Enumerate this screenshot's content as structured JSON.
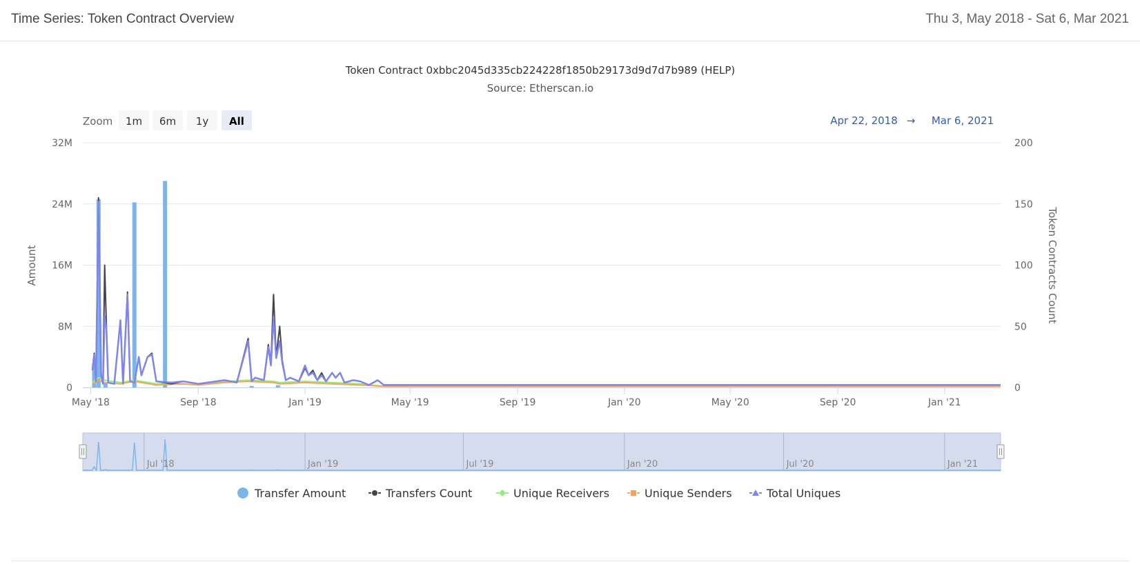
{
  "header": {
    "title": "Time Series: Token Contract Overview",
    "date_range": "Thu 3, May 2018 - Sat 6, Mar 2021"
  },
  "range_selector": {
    "zoom_label": "Zoom",
    "buttons": [
      "1m",
      "6m",
      "1y",
      "All"
    ],
    "active": "All",
    "from": "Apr 22, 2018",
    "arrow": "→",
    "to": "Mar 6, 2021"
  },
  "colors": {
    "transfer_amount": "#7cb5ec",
    "transfers_count": "#434348",
    "unique_receivers": "#90ed7d",
    "unique_senders": "#f7a35c",
    "total_uniques": "#8085e9",
    "navigator_fill": "#ccd6eb"
  },
  "chart_data": {
    "type": "line",
    "title": "Token Contract 0xbbc2045d335cb224228f1850b29173d9d7d7b989 (HELP)",
    "subtitle": "Source: Etherscan.io",
    "x_range": [
      "2018-04-22",
      "2021-03-06"
    ],
    "x_ticks": [
      "May '18",
      "Sep '18",
      "Jan '19",
      "May '19",
      "Sep '19",
      "Jan '20",
      "May '20",
      "Sep '20",
      "Jan '21"
    ],
    "y_left": {
      "label": "Amount",
      "range": [
        0,
        32000000
      ],
      "ticks": [
        "0",
        "8M",
        "16M",
        "24M",
        "32M"
      ]
    },
    "y_right": {
      "label": "Token Contracts Count",
      "range": [
        0,
        200
      ],
      "ticks": [
        "0",
        "50",
        "100",
        "150",
        "200"
      ]
    },
    "navigator_ticks": [
      "Jul '18",
      "Jan '19",
      "Jul '19",
      "Jan '20",
      "Jul '20",
      "Jan '21"
    ],
    "legend": [
      "Transfer Amount",
      "Transfers Count",
      "Unique Receivers",
      "Unique Senders",
      "Total Uniques"
    ],
    "series": [
      {
        "name": "Transfer Amount",
        "type": "column",
        "axis": "left",
        "points": [
          [
            "2018-05-05",
            3000000
          ],
          [
            "2018-05-10",
            24600000
          ],
          [
            "2018-05-18",
            600000
          ],
          [
            "2018-06-20",
            24200000
          ],
          [
            "2018-07-25",
            27000000
          ],
          [
            "2018-11-01",
            200000
          ],
          [
            "2018-12-01",
            300000
          ]
        ]
      },
      {
        "name": "Transfers Count",
        "axis": "right",
        "points": [
          [
            "2018-05-03",
            15
          ],
          [
            "2018-05-05",
            28
          ],
          [
            "2018-05-07",
            5
          ],
          [
            "2018-05-10",
            155
          ],
          [
            "2018-05-13",
            10
          ],
          [
            "2018-05-15",
            3
          ],
          [
            "2018-05-17",
            100
          ],
          [
            "2018-05-19",
            50
          ],
          [
            "2018-05-21",
            4
          ],
          [
            "2018-05-28",
            3
          ],
          [
            "2018-06-04",
            55
          ],
          [
            "2018-06-07",
            3
          ],
          [
            "2018-06-12",
            78
          ],
          [
            "2018-06-15",
            5
          ],
          [
            "2018-06-20",
            4
          ],
          [
            "2018-06-25",
            25
          ],
          [
            "2018-06-28",
            10
          ],
          [
            "2018-07-05",
            25
          ],
          [
            "2018-07-10",
            28
          ],
          [
            "2018-07-15",
            5
          ],
          [
            "2018-08-01",
            3
          ],
          [
            "2018-08-15",
            5
          ],
          [
            "2018-09-01",
            3
          ],
          [
            "2018-10-01",
            6
          ],
          [
            "2018-10-15",
            4
          ],
          [
            "2018-10-28",
            40
          ],
          [
            "2018-11-01",
            5
          ],
          [
            "2018-11-05",
            8
          ],
          [
            "2018-11-15",
            6
          ],
          [
            "2018-11-20",
            35
          ],
          [
            "2018-11-23",
            20
          ],
          [
            "2018-11-26",
            76
          ],
          [
            "2018-11-29",
            25
          ],
          [
            "2018-12-03",
            50
          ],
          [
            "2018-12-06",
            22
          ],
          [
            "2018-12-10",
            6
          ],
          [
            "2018-12-15",
            8
          ],
          [
            "2018-12-25",
            5
          ],
          [
            "2019-01-01",
            16
          ],
          [
            "2019-01-05",
            10
          ],
          [
            "2019-01-10",
            14
          ],
          [
            "2019-01-15",
            6
          ],
          [
            "2019-01-20",
            12
          ],
          [
            "2019-01-25",
            5
          ],
          [
            "2019-02-01",
            12
          ],
          [
            "2019-02-05",
            8
          ],
          [
            "2019-02-10",
            12
          ],
          [
            "2019-02-15",
            4
          ],
          [
            "2019-02-25",
            6
          ],
          [
            "2019-03-05",
            5
          ],
          [
            "2019-03-15",
            2
          ],
          [
            "2019-03-25",
            6
          ],
          [
            "2019-04-01",
            2
          ],
          [
            "2019-04-15",
            2
          ],
          [
            "2019-07-01",
            2
          ],
          [
            "2020-01-01",
            2
          ],
          [
            "2020-07-01",
            2
          ],
          [
            "2021-03-06",
            2
          ]
        ]
      },
      {
        "name": "Unique Receivers",
        "axis": "right",
        "points": [
          [
            "2018-05-03",
            4
          ],
          [
            "2018-05-10",
            8
          ],
          [
            "2018-05-17",
            6
          ],
          [
            "2018-06-04",
            4
          ],
          [
            "2018-06-20",
            6
          ],
          [
            "2018-07-15",
            3
          ],
          [
            "2018-08-15",
            3
          ],
          [
            "2018-09-01",
            2
          ],
          [
            "2018-10-01",
            5
          ],
          [
            "2018-10-28",
            6
          ],
          [
            "2018-11-26",
            5
          ],
          [
            "2018-12-03",
            4
          ],
          [
            "2019-01-01",
            5
          ],
          [
            "2019-02-01",
            4
          ],
          [
            "2019-03-05",
            3
          ],
          [
            "2019-04-01",
            1
          ],
          [
            "2021-03-06",
            1
          ]
        ]
      },
      {
        "name": "Unique Senders",
        "axis": "right",
        "points": [
          [
            "2018-05-03",
            3
          ],
          [
            "2018-05-10",
            6
          ],
          [
            "2018-05-17",
            4
          ],
          [
            "2018-06-04",
            3
          ],
          [
            "2018-06-20",
            5
          ],
          [
            "2018-07-15",
            2
          ],
          [
            "2018-08-15",
            3
          ],
          [
            "2018-09-01",
            2
          ],
          [
            "2018-10-01",
            4
          ],
          [
            "2018-10-28",
            5
          ],
          [
            "2018-11-26",
            4
          ],
          [
            "2018-12-03",
            3
          ],
          [
            "2019-01-01",
            4
          ],
          [
            "2019-02-01",
            3
          ],
          [
            "2019-03-05",
            2
          ],
          [
            "2019-04-01",
            1
          ],
          [
            "2021-03-06",
            1
          ]
        ]
      },
      {
        "name": "Total Uniques",
        "axis": "right",
        "points": [
          [
            "2018-05-03",
            14
          ],
          [
            "2018-05-05",
            27
          ],
          [
            "2018-05-07",
            5
          ],
          [
            "2018-05-10",
            152
          ],
          [
            "2018-05-13",
            10
          ],
          [
            "2018-05-15",
            3
          ],
          [
            "2018-05-17",
            58
          ],
          [
            "2018-05-19",
            48
          ],
          [
            "2018-05-21",
            4
          ],
          [
            "2018-05-28",
            3
          ],
          [
            "2018-06-04",
            55
          ],
          [
            "2018-06-07",
            3
          ],
          [
            "2018-06-12",
            76
          ],
          [
            "2018-06-15",
            5
          ],
          [
            "2018-06-20",
            4
          ],
          [
            "2018-06-25",
            25
          ],
          [
            "2018-06-28",
            10
          ],
          [
            "2018-07-05",
            25
          ],
          [
            "2018-07-10",
            27
          ],
          [
            "2018-07-15",
            5
          ],
          [
            "2018-08-01",
            4
          ],
          [
            "2018-08-15",
            5
          ],
          [
            "2018-09-01",
            3
          ],
          [
            "2018-10-01",
            6
          ],
          [
            "2018-10-15",
            4
          ],
          [
            "2018-10-28",
            38
          ],
          [
            "2018-11-01",
            5
          ],
          [
            "2018-11-05",
            8
          ],
          [
            "2018-11-15",
            6
          ],
          [
            "2018-11-20",
            33
          ],
          [
            "2018-11-23",
            18
          ],
          [
            "2018-11-26",
            58
          ],
          [
            "2018-11-29",
            24
          ],
          [
            "2018-12-03",
            38
          ],
          [
            "2018-12-06",
            20
          ],
          [
            "2018-12-10",
            6
          ],
          [
            "2018-12-15",
            8
          ],
          [
            "2018-12-25",
            5
          ],
          [
            "2019-01-01",
            18
          ],
          [
            "2019-01-05",
            10
          ],
          [
            "2019-01-10",
            12
          ],
          [
            "2019-01-15",
            6
          ],
          [
            "2019-01-20",
            10
          ],
          [
            "2019-01-25",
            5
          ],
          [
            "2019-02-01",
            12
          ],
          [
            "2019-02-05",
            8
          ],
          [
            "2019-02-10",
            12
          ],
          [
            "2019-02-15",
            4
          ],
          [
            "2019-02-25",
            6
          ],
          [
            "2019-03-05",
            5
          ],
          [
            "2019-03-15",
            2
          ],
          [
            "2019-03-25",
            6
          ],
          [
            "2019-04-01",
            2
          ],
          [
            "2019-04-15",
            2
          ],
          [
            "2019-07-01",
            2
          ],
          [
            "2020-01-01",
            2
          ],
          [
            "2020-07-01",
            2
          ],
          [
            "2021-03-06",
            2
          ]
        ]
      }
    ]
  }
}
